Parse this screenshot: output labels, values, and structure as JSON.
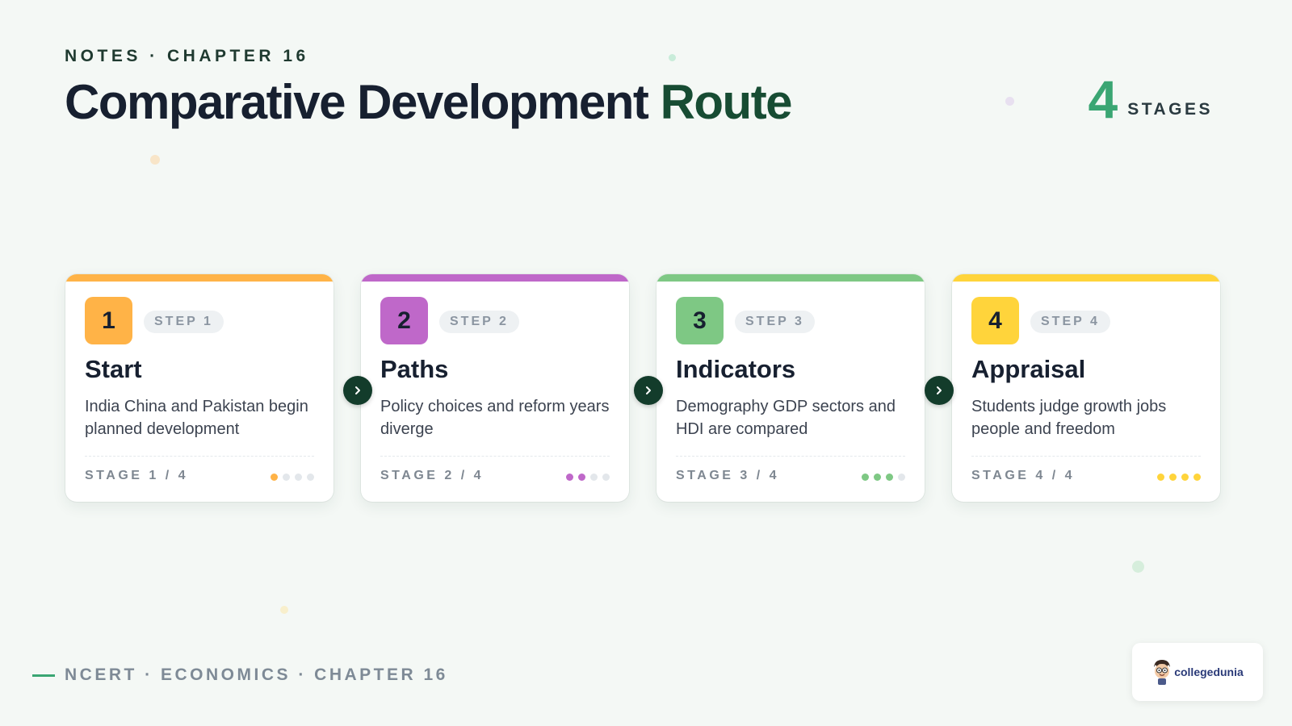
{
  "header": {
    "eyebrow": "NOTES · CHAPTER 16",
    "title_main": "Comparative Development",
    "title_accent": "Route",
    "stage_count": "4",
    "stage_count_label": "STAGES"
  },
  "colors": {
    "background": "#f4f8f5",
    "title_accent": "#174c33",
    "count_accent": "#3aa673",
    "arrow": "#133c2b"
  },
  "steps": [
    {
      "number": "1",
      "step_label": "STEP 1",
      "title": "Start",
      "description": "India China and Pakistan begin planned development",
      "stage_label": "STAGE 1 / 4",
      "progress": 1,
      "total": 4,
      "color": "#ffb347"
    },
    {
      "number": "2",
      "step_label": "STEP 2",
      "title": "Paths",
      "description": "Policy choices and reform years diverge",
      "stage_label": "STAGE 2 / 4",
      "progress": 2,
      "total": 4,
      "color": "#bf68c9"
    },
    {
      "number": "3",
      "step_label": "STEP 3",
      "title": "Indicators",
      "description": "Demography GDP sectors and HDI are compared",
      "stage_label": "STAGE 3 / 4",
      "progress": 3,
      "total": 4,
      "color": "#7ec884"
    },
    {
      "number": "4",
      "step_label": "STEP 4",
      "title": "Appraisal",
      "description": "Students judge growth jobs people and freedom",
      "stage_label": "STAGE 4 / 4",
      "progress": 4,
      "total": 4,
      "color": "#ffd43b"
    }
  ],
  "footer": {
    "text": "NCERT · ECONOMICS · CHAPTER 16"
  },
  "logo": {
    "text": "collegedunia",
    "icon": "mascot-icon"
  }
}
